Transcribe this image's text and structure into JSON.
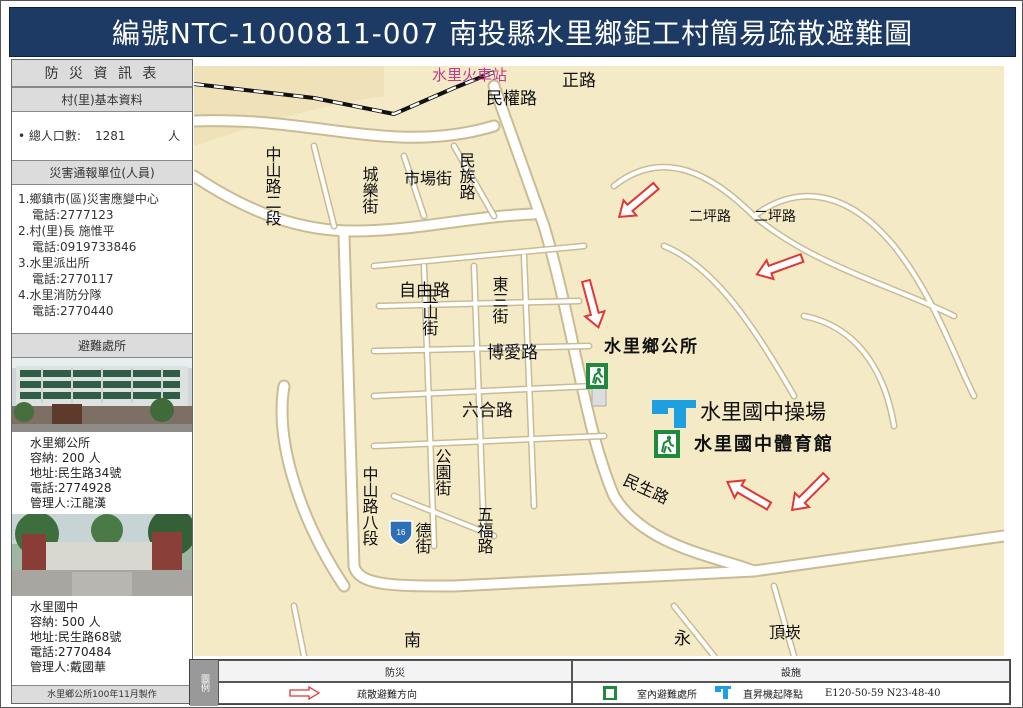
{
  "title": "編號NTC-1000811-007  南投縣水里鄉鉅工村簡易疏散避難圖",
  "sidebar": {
    "header": "防 災 資 訊 表",
    "village_basic": "村(里)基本資料",
    "population_label": "• 總人口數:",
    "population_value": "1281",
    "population_unit": "人",
    "report_header": "災害通報單位(人員)",
    "report_lines": [
      "1.鄉鎮市(區)災害應變中心",
      "電話:2777123",
      "2.村(里)長 施惟平",
      "電話:0919733846",
      "3.水里派出所",
      "電話:2770117",
      "4.水里消防分隊",
      "電話:2770440"
    ],
    "shelter_header": "避難處所",
    "shelters": [
      {
        "name": "水里鄉公所",
        "capacity": "容納:  200  人",
        "address": "地址:民生路34號",
        "phone": "電話:2774928",
        "manager": "管理人:江龍漢"
      },
      {
        "name": "水里國中",
        "capacity": "容納:  500  人",
        "address": "地址:民生路68號",
        "phone": "電話:2770484",
        "manager": "管理人:戴國華"
      }
    ],
    "footer": "水里鄉公所100年11月製作"
  },
  "map": {
    "station": "水里火車站",
    "roads": [
      "民權路",
      "正路",
      "中山路二段",
      "城樂街",
      "市場街",
      "民族路",
      "自由路",
      "玉山街",
      "東三街",
      "博愛路",
      "六合路",
      "公園街",
      "五福路",
      "中山路八段",
      "德街",
      "民生路",
      "二坪路",
      "二坪路",
      "南",
      "永",
      "頂崁"
    ],
    "places": {
      "office": "水里鄉公所",
      "field": "水里國中操場",
      "gym": "水里國中體育館"
    }
  },
  "legend": {
    "side_label": "圖例",
    "col1_header": "防災",
    "col2_header": "設施",
    "evac_label": "疏散避難方向",
    "indoor_label": "室內避難處所",
    "heli_label": "直昇機起降點",
    "coords": "E120-50-59    N23-48-40"
  },
  "colors": {
    "title_bg": "#1c3a63",
    "map_bg": "#f5eac6",
    "road": "#ffffff",
    "arrow": "#e23636",
    "shelter_icon": "#1f8a3c",
    "heli_icon": "#1ea0e0"
  }
}
